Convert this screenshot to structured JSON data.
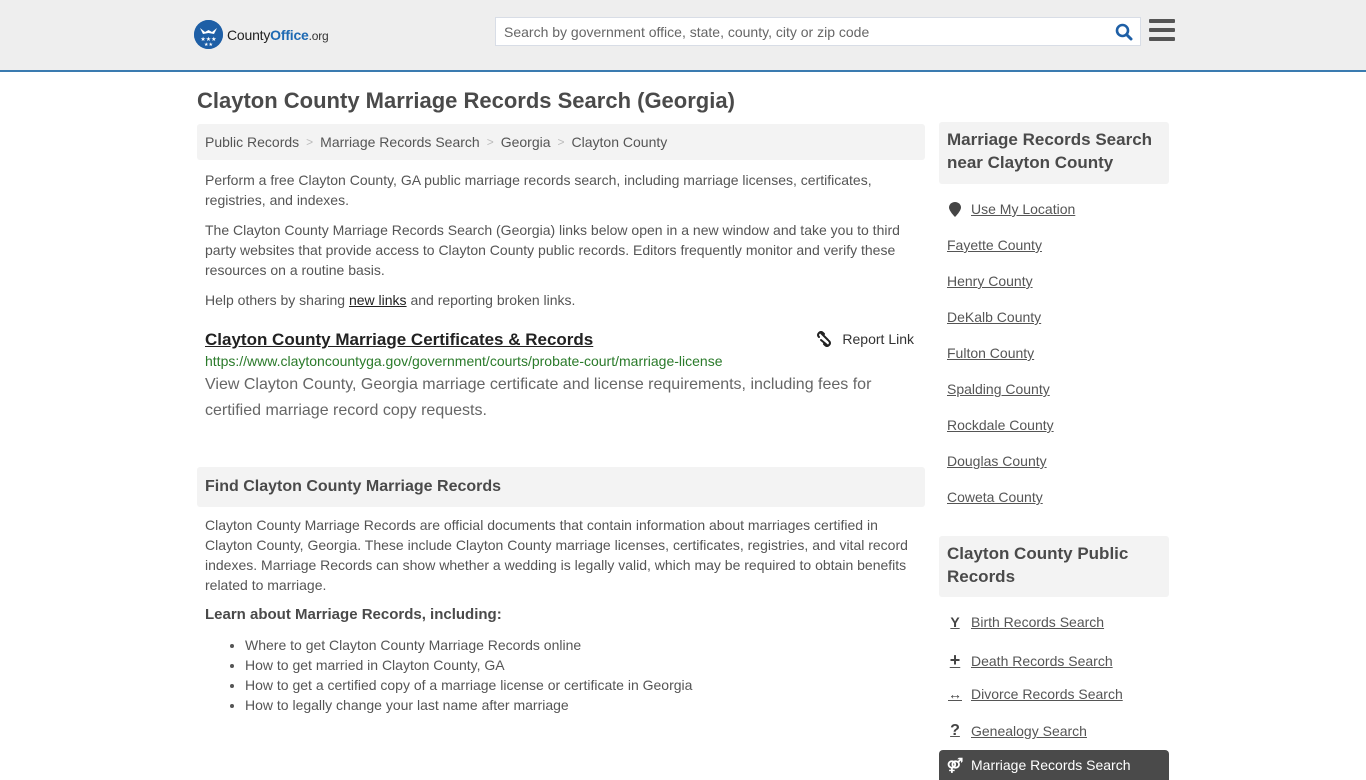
{
  "header": {
    "logo": {
      "county": "County",
      "office": "Office",
      "org": ".org"
    },
    "search_placeholder": "Search by government office, state, county, city or zip code",
    "search_value": "",
    "colors": {
      "brand_blue": "#1e5fa6",
      "header_border": "#3a7bb0",
      "header_bg": "#eeeeee"
    }
  },
  "page": {
    "title": "Clayton County Marriage Records Search (Georgia)"
  },
  "breadcrumb": [
    {
      "label": "Public Records"
    },
    {
      "label": "Marriage Records Search"
    },
    {
      "label": "Georgia"
    },
    {
      "label": "Clayton County"
    }
  ],
  "intro": {
    "p1": "Perform a free Clayton County, GA public marriage records search, including marriage licenses, certificates, registries, and indexes.",
    "p2": "The Clayton County Marriage Records Search (Georgia) links below open in a new window and take you to third party websites that provide access to Clayton County public records. Editors frequently monitor and verify these resources on a routine basis.",
    "p3_before": "Help others by sharing ",
    "p3_link": "new links",
    "p3_after": " and reporting broken links."
  },
  "result": {
    "title": "Clayton County Marriage Certificates & Records",
    "report_label": "Report Link",
    "url": "https://www.claytoncountyga.gov/government/courts/probate-court/marriage-license",
    "description": "View Clayton County, Georgia marriage certificate and license requirements, including fees for certified marriage record copy requests.",
    "url_color": "#2a7a2a"
  },
  "find_section": {
    "heading": "Find Clayton County Marriage Records",
    "body": "Clayton County Marriage Records are official documents that contain information about marriages certified in Clayton County, Georgia. These include Clayton County marriage licenses, certificates, registries, and vital record indexes. Marriage Records can show whether a wedding is legally valid, which may be required to obtain benefits related to marriage.",
    "learn_heading": "Learn about Marriage Records, including:",
    "learn_items": [
      "Where to get Clayton County Marriage Records online",
      "How to get married in Clayton County, GA",
      "How to get a certified copy of a marriage license or certificate in Georgia",
      "How to legally change your last name after marriage"
    ]
  },
  "sidebar": {
    "nearby_heading": "Marriage Records Search near Clayton County",
    "use_location": {
      "label": "Use My Location",
      "icon": "map-marker-icon"
    },
    "nearby": [
      {
        "label": "Fayette County"
      },
      {
        "label": "Henry County"
      },
      {
        "label": "DeKalb County"
      },
      {
        "label": "Fulton County"
      },
      {
        "label": "Spalding County"
      },
      {
        "label": "Rockdale County"
      },
      {
        "label": "Douglas County"
      },
      {
        "label": "Coweta County"
      }
    ],
    "public_heading": "Clayton County Public Records",
    "public_records": [
      {
        "label": "Birth Records Search",
        "icon": "child-icon",
        "glyph": "Y"
      },
      {
        "label": "Death Records Search",
        "icon": "plus-icon",
        "glyph": "+"
      },
      {
        "label": "Divorce Records Search",
        "icon": "arrows-horizontal-icon",
        "glyph": "↔"
      },
      {
        "label": "Genealogy Search",
        "icon": "question-icon",
        "glyph": "?"
      }
    ],
    "active_item": {
      "label": "Marriage Records Search",
      "icon": "marriage-icon",
      "glyph": "⚤"
    },
    "active_bg": "#4a4a4a"
  }
}
